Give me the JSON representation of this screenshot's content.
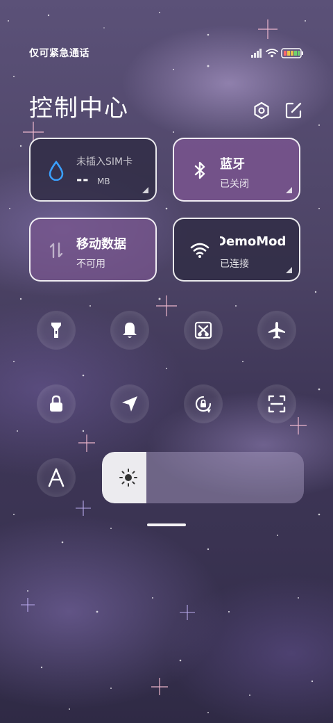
{
  "status_bar": {
    "carrier_text": "仅可紧急通话",
    "icons": [
      "signal-icon",
      "wifi-icon",
      "battery-icon"
    ],
    "battery_color": "#e8c64a"
  },
  "header": {
    "title": "控制中心",
    "icons": [
      "settings-icon",
      "edit-icon"
    ]
  },
  "tiles": {
    "data_usage": {
      "label": "未插入SIM卡",
      "value": "--",
      "unit": "MB",
      "icon": "water-drop-icon",
      "icon_color": "#3aa0ff"
    },
    "bluetooth": {
      "label": "蓝牙",
      "status": "已关闭",
      "icon": "bluetooth-icon"
    },
    "mobile_data": {
      "label": "移动数据",
      "status": "不可用",
      "icon": "data-arrows-icon"
    },
    "wifi": {
      "label": "DemoMod",
      "status": "已连接",
      "icon": "wifi-icon"
    }
  },
  "toggles_row1": [
    {
      "name": "flashlight",
      "icon": "flashlight-icon"
    },
    {
      "name": "ringer",
      "icon": "bell-icon"
    },
    {
      "name": "screenshot",
      "icon": "scissors-screenshot-icon"
    },
    {
      "name": "airplane-mode",
      "icon": "airplane-icon"
    }
  ],
  "toggles_row2": [
    {
      "name": "lock-screen",
      "icon": "lock-icon"
    },
    {
      "name": "location",
      "icon": "location-arrow-icon"
    },
    {
      "name": "rotation-lock",
      "icon": "rotation-lock-icon"
    },
    {
      "name": "scanner",
      "icon": "scan-icon"
    }
  ],
  "auto_brightness": {
    "icon": "auto-brightness-icon"
  },
  "brightness": {
    "level_percent": 22,
    "icon": "sun-icon"
  },
  "colors": {
    "tile_purple": "#76548c",
    "tile_dark": "#302c44"
  }
}
